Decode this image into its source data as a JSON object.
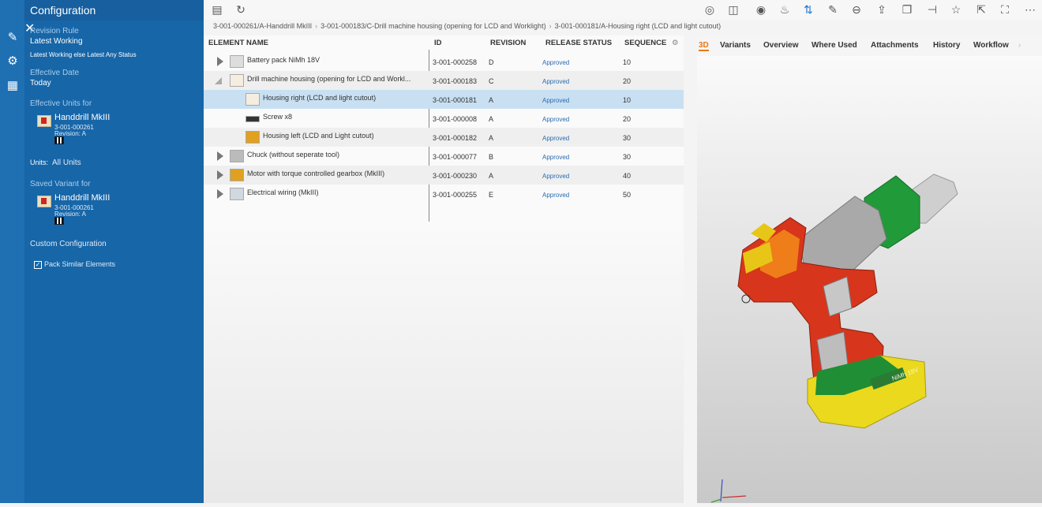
{
  "panel": {
    "title": "Configuration",
    "revision_rule_label": "Revision Rule",
    "revision_rule_value": "Latest Working",
    "revision_rule_detail": "Latest Working else Latest Any Status",
    "effective_date_label": "Effective Date",
    "effective_date_value": "Today",
    "effective_units_label": "Effective Units for",
    "unit_name": "Handdrill MkIII",
    "unit_id": "3-001-000261",
    "unit_revision": "Revision:  A",
    "units_label": "Units:",
    "units_value": "All Units",
    "saved_variant_label": "Saved Variant for",
    "variant_name": "Handdrill MkIII",
    "variant_id": "3-001-000261",
    "variant_revision": "Revision:  A",
    "custom_configuration": "Custom Configuration",
    "pack_similar": "Pack Similar Elements"
  },
  "breadcrumb": [
    "3-001-000261/A-Handdrill MkIII",
    "3-001-000183/C-Drill machine housing (opening for LCD and Worklight)",
    "3-001-000181/A-Housing right (LCD and light cutout)"
  ],
  "table": {
    "headers": {
      "name": "ELEMENT NAME",
      "id": "ID",
      "revision": "REVISION",
      "status": "RELEASE STATUS",
      "sequence": "SEQUENCE"
    },
    "rows": [
      {
        "name": "Battery pack NiMh 18V",
        "id": "3-001-000258",
        "rev": "D",
        "status": "Approved",
        "seq": "10"
      },
      {
        "name": "Drill machine housing (opening for LCD and Workl...",
        "id": "3-001-000183",
        "rev": "C",
        "status": "Approved",
        "seq": "20"
      },
      {
        "name": "Housing right (LCD and light cutout)",
        "id": "3-001-000181",
        "rev": "A",
        "status": "Approved",
        "seq": "10"
      },
      {
        "name": "Screw x8",
        "id": "3-001-000008",
        "rev": "A",
        "status": "Approved",
        "seq": "20"
      },
      {
        "name": "Housing left (LCD and Light cutout)",
        "id": "3-001-000182",
        "rev": "A",
        "status": "Approved",
        "seq": "30"
      },
      {
        "name": "Chuck (without seperate tool)",
        "id": "3-001-000077",
        "rev": "B",
        "status": "Approved",
        "seq": "30"
      },
      {
        "name": "Motor with torque controlled gearbox (MkIII)",
        "id": "3-001-000230",
        "rev": "A",
        "status": "Approved",
        "seq": "40"
      },
      {
        "name": "Electrical wiring (MkIII)",
        "id": "3-001-000255",
        "rev": "E",
        "status": "Approved",
        "seq": "50"
      }
    ]
  },
  "tabs": [
    "3D",
    "Variants",
    "Overview",
    "Where Used",
    "Attachments",
    "History",
    "Workflow"
  ],
  "viewer": {
    "battery_label": "NiMh 18V"
  },
  "colors": {
    "accent": "#e87817",
    "panel": "#1766a8",
    "rail": "#1f6fb3",
    "selection": "#c8e0f2",
    "status": "#2b6cb0"
  }
}
